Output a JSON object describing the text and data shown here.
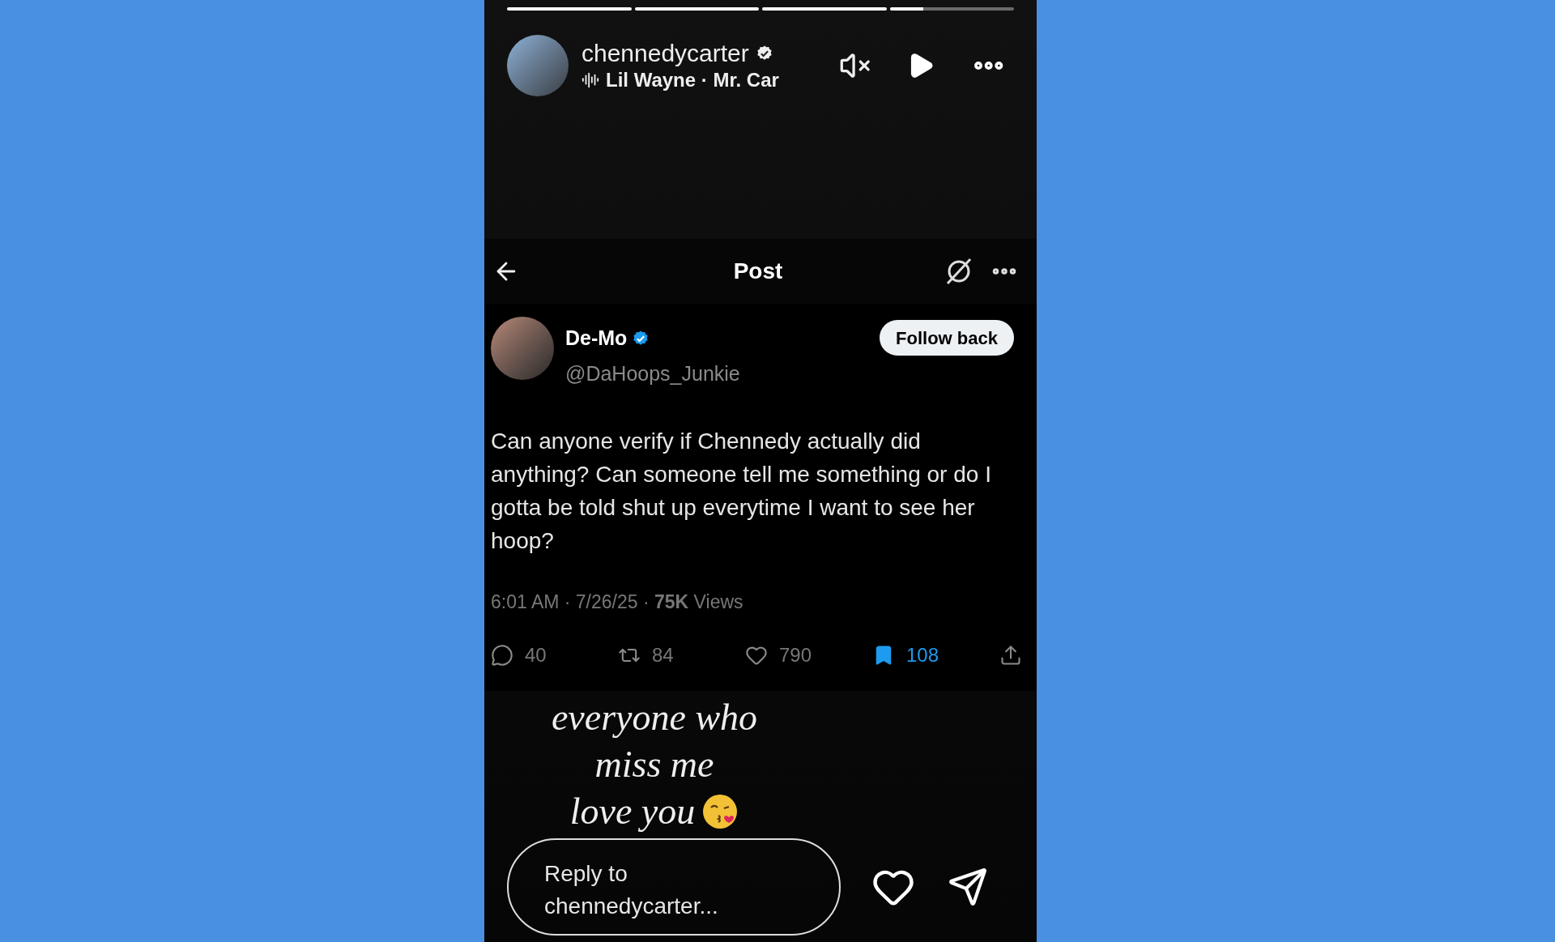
{
  "story": {
    "progress": [
      {
        "level": 1
      },
      {
        "level": 1
      },
      {
        "level": 1
      },
      {
        "level": 0.27
      }
    ],
    "username": "chennedycarter",
    "verified": true,
    "music": "Lil Wayne · Mr. Car"
  },
  "post": {
    "title": "Post",
    "author": {
      "name": "De-Mo",
      "verified": true,
      "handle": "@DaHoops_Junkie"
    },
    "follow_button": "Follow back",
    "text": "Can anyone verify if Chennedy actually did anything? Can someone tell me something or do I gotta be told shut up everytime I want to see her hoop?",
    "meta": "6:01 AM · 7/26/25 · **75K** Views",
    "actions": [
      {
        "kind": "reply",
        "count": "40",
        "selected": false
      },
      {
        "kind": "repost",
        "count": "84",
        "selected": false
      },
      {
        "kind": "like",
        "count": "790",
        "selected": false
      },
      {
        "kind": "bookmark",
        "count": "108",
        "selected": true
      },
      {
        "kind": "share",
        "selected": false
      }
    ]
  },
  "caption": [
    "everyone who",
    "miss me",
    "love you"
  ],
  "reply": {
    "placeholder": "Reply to chennedycarter..."
  }
}
